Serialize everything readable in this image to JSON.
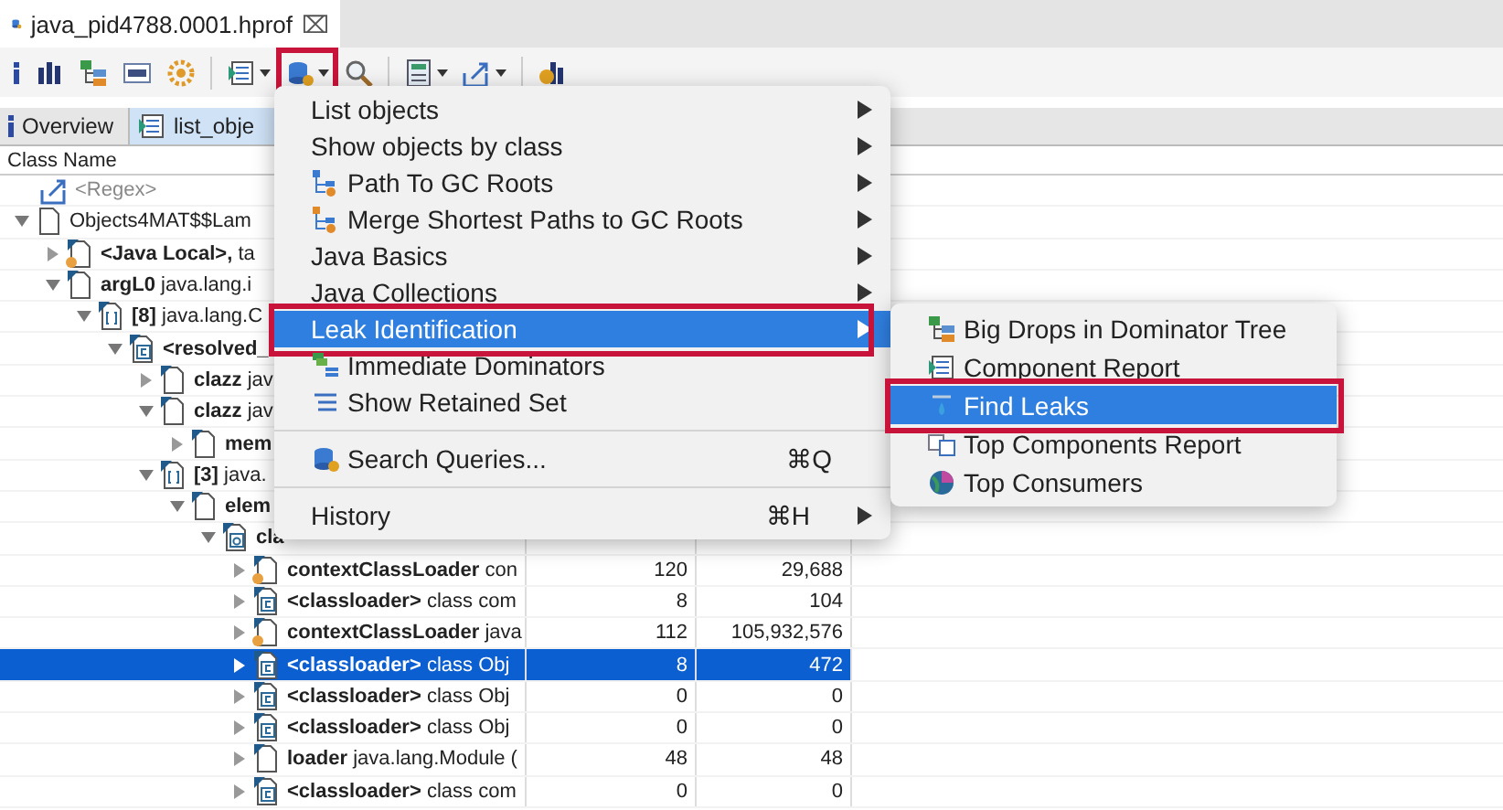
{
  "editor_tab": {
    "title": "java_pid4788.0001.hprof",
    "close": "⌧"
  },
  "toolbar": [
    {
      "kind": "info",
      "dropdown": false,
      "annotated": false
    },
    {
      "kind": "histogram",
      "dropdown": false,
      "annotated": false
    },
    {
      "kind": "tree",
      "dropdown": false,
      "annotated": false
    },
    {
      "kind": "oql",
      "dropdown": false,
      "annotated": false
    },
    {
      "kind": "gear",
      "dropdown": false,
      "annotated": false
    },
    {
      "kind": "separator"
    },
    {
      "kind": "report",
      "dropdown": true,
      "annotated": false
    },
    {
      "kind": "queries",
      "dropdown": true,
      "annotated": true
    },
    {
      "kind": "search",
      "dropdown": false,
      "annotated": false
    },
    {
      "kind": "separator"
    },
    {
      "kind": "calculator",
      "dropdown": true,
      "annotated": false
    },
    {
      "kind": "export",
      "dropdown": true,
      "annotated": false
    },
    {
      "kind": "separator"
    },
    {
      "kind": "chart",
      "dropdown": false,
      "annotated": false
    }
  ],
  "view_tabs": [
    {
      "label": "Overview",
      "kind": "info",
      "selected": false
    },
    {
      "label": "list_obje",
      "kind": "list",
      "selected": true
    }
  ],
  "tree": {
    "columns": [
      "Class Name"
    ],
    "filter": "<Regex>",
    "rows": [
      {
        "detail": "Objects4MAT$$Lam",
        "kind": "plain",
        "gc_root": false,
        "expanded": true,
        "selected": false,
        "children": [
          {
            "name": "<Java Local>,",
            "detail": "ta",
            "kind": "object",
            "gc_root": true,
            "expanded": false,
            "selected": false
          },
          {
            "name": "argL0",
            "detail": "java.lang.i",
            "kind": "object",
            "gc_root": false,
            "expanded": true,
            "selected": false,
            "children": [
              {
                "name": "[8]",
                "detail": "java.lang.C",
                "kind": "array",
                "gc_root": false,
                "expanded": true,
                "selected": false,
                "children": [
                  {
                    "name": "<resolved_",
                    "kind": "class",
                    "gc_root": false,
                    "expanded": true,
                    "selected": false,
                    "children": [
                      {
                        "name": "clazz",
                        "detail": "jav",
                        "kind": "object",
                        "gc_root": false,
                        "expanded": false,
                        "selected": false
                      },
                      {
                        "name": "clazz",
                        "detail": "jav",
                        "kind": "object",
                        "gc_root": false,
                        "expanded": true,
                        "selected": false,
                        "children": [
                          {
                            "name": "mem",
                            "kind": "object",
                            "gc_root": false,
                            "expanded": false,
                            "selected": false
                          }
                        ]
                      },
                      {
                        "name": "[3]",
                        "detail": "java.",
                        "kind": "array",
                        "gc_root": false,
                        "expanded": true,
                        "selected": false,
                        "children": [
                          {
                            "name": "elem",
                            "kind": "object",
                            "gc_root": false,
                            "expanded": true,
                            "selected": false,
                            "children": [
                              {
                                "name": "cla",
                                "kind": "instance",
                                "gc_root": false,
                                "expanded": true,
                                "selected": false,
                                "children": [
                                  {
                                    "name": "contextClassLoader",
                                    "detail": "con",
                                    "kind": "object",
                                    "gc_root": true,
                                    "expanded": false,
                                    "selected": false,
                                    "shallow": "120",
                                    "retained": "29,688"
                                  },
                                  {
                                    "name": "<classloader>",
                                    "detail": "class com",
                                    "kind": "class",
                                    "gc_root": false,
                                    "expanded": false,
                                    "selected": false,
                                    "shallow": "8",
                                    "retained": "104"
                                  },
                                  {
                                    "name": "contextClassLoader",
                                    "detail": "java",
                                    "kind": "object",
                                    "gc_root": true,
                                    "expanded": false,
                                    "selected": false,
                                    "shallow": "112",
                                    "retained": "105,932,576"
                                  },
                                  {
                                    "name": "<classloader>",
                                    "detail": "class Obj",
                                    "kind": "class",
                                    "gc_root": false,
                                    "expanded": false,
                                    "selected": true,
                                    "shallow": "8",
                                    "retained": "472"
                                  },
                                  {
                                    "name": "<classloader>",
                                    "detail": "class Obj",
                                    "kind": "class",
                                    "gc_root": false,
                                    "expanded": false,
                                    "selected": false,
                                    "shallow": "0",
                                    "retained": "0"
                                  },
                                  {
                                    "name": "<classloader>",
                                    "detail": "class Obj",
                                    "kind": "class",
                                    "gc_root": false,
                                    "expanded": false,
                                    "selected": false,
                                    "shallow": "0",
                                    "retained": "0"
                                  },
                                  {
                                    "name": "loader",
                                    "detail": "java.lang.Module (",
                                    "kind": "object",
                                    "gc_root": false,
                                    "expanded": false,
                                    "selected": false,
                                    "shallow": "48",
                                    "retained": "48"
                                  },
                                  {
                                    "name": "<classloader>",
                                    "detail": "class com",
                                    "kind": "class",
                                    "gc_root": false,
                                    "expanded": false,
                                    "selected": false,
                                    "shallow": "0",
                                    "retained": "0"
                                  }
                                ]
                              }
                            ]
                          }
                        ]
                      }
                    ]
                  }
                ]
              }
            ]
          }
        ]
      }
    ]
  },
  "menu": [
    {
      "kind": "text",
      "label": "List objects",
      "submenu": true,
      "selected": false,
      "annotated": false
    },
    {
      "kind": "text",
      "label": "Show objects by class",
      "submenu": true,
      "selected": false,
      "annotated": false
    },
    {
      "kind": "path",
      "label": "Path To GC Roots",
      "submenu": true,
      "selected": false,
      "annotated": false
    },
    {
      "kind": "merge",
      "label": "Merge Shortest Paths to GC Roots",
      "submenu": true,
      "selected": false,
      "annotated": false
    },
    {
      "kind": "text",
      "label": "Java Basics",
      "submenu": true,
      "selected": false,
      "annotated": false
    },
    {
      "kind": "text",
      "label": "Java Collections",
      "submenu": true,
      "selected": false,
      "annotated": false
    },
    {
      "kind": "text",
      "label": "Leak Identification",
      "submenu": true,
      "selected": true,
      "annotated": true
    },
    {
      "kind": "dominators",
      "label": "Immediate Dominators",
      "submenu": false,
      "selected": false,
      "annotated": false
    },
    {
      "kind": "retained",
      "label": "Show Retained Set",
      "submenu": false,
      "selected": false,
      "annotated": false
    },
    {
      "kind": "separator"
    },
    {
      "kind": "queries",
      "label": "Search Queries...",
      "shortcut": "⌘Q",
      "submenu": false,
      "selected": false,
      "annotated": false
    },
    {
      "kind": "separator"
    },
    {
      "kind": "text",
      "label": "History",
      "shortcut": "⌘H",
      "submenu": true,
      "selected": false,
      "annotated": false
    }
  ],
  "submenu": [
    {
      "label": "Big Drops in Dominator Tree",
      "kind": "tree",
      "selected": false,
      "annotated": false
    },
    {
      "label": "Component Report",
      "kind": "report",
      "selected": false,
      "annotated": false
    },
    {
      "label": "Find Leaks",
      "kind": "leak",
      "selected": true,
      "annotated": true
    },
    {
      "label": "Top Components Report",
      "kind": "components",
      "selected": false,
      "annotated": false
    },
    {
      "label": "Top Consumers",
      "kind": "globe",
      "selected": false,
      "annotated": false
    }
  ]
}
